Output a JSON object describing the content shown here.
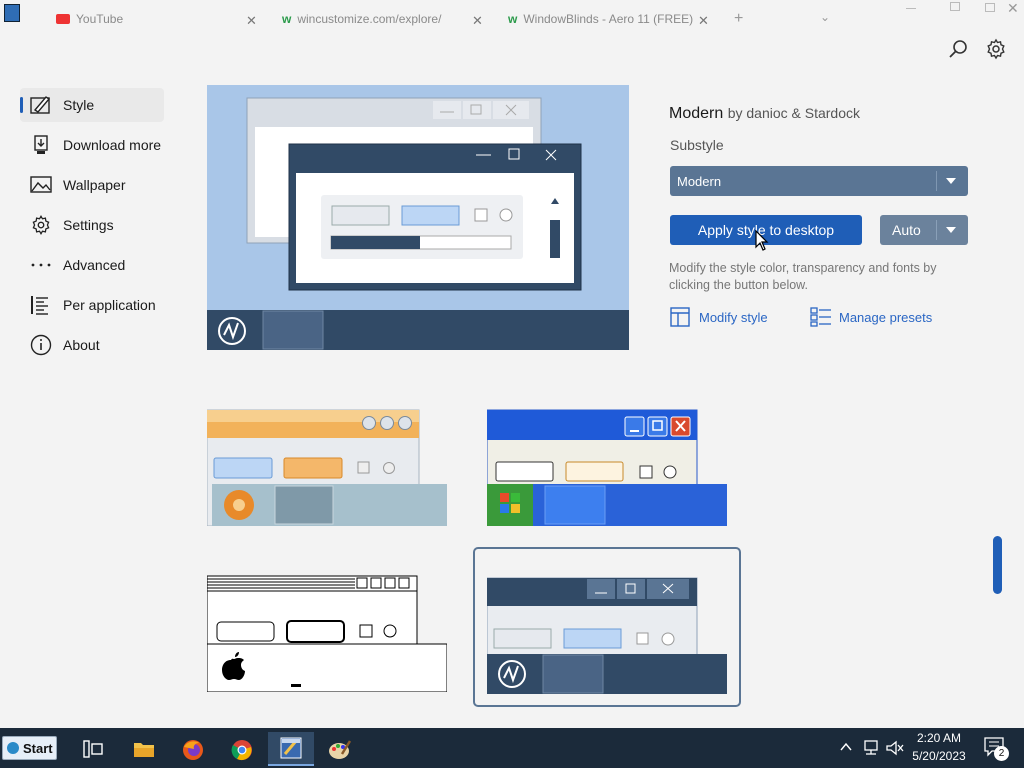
{
  "browser": {
    "tabs": [
      {
        "title": "YouTube"
      },
      {
        "title": "wincustomize.com/explore/"
      },
      {
        "title": "WindowBlinds - Aero 11 (FREE)"
      }
    ]
  },
  "sidebar": {
    "items": [
      {
        "label": "Style",
        "icon": "paint-brush-icon"
      },
      {
        "label": "Download more",
        "icon": "download-icon"
      },
      {
        "label": "Wallpaper",
        "icon": "image-icon"
      },
      {
        "label": "Settings",
        "icon": "gear-icon"
      },
      {
        "label": "Advanced",
        "icon": "more-dots-icon"
      },
      {
        "label": "Per application",
        "icon": "list-icon"
      },
      {
        "label": "About",
        "icon": "info-icon"
      }
    ]
  },
  "style": {
    "name": "Modern",
    "by": "by danioc & Stardock",
    "substyle_label": "Substyle",
    "substyle_value": "Modern",
    "apply_label": "Apply style to desktop",
    "auto_label": "Auto",
    "description": "Modify the style color, transparency and fonts by clicking the button below.",
    "modify_label": "Modify style",
    "presets_label": "Manage presets"
  },
  "taskbar": {
    "start_label": "Start",
    "time": "2:20 AM",
    "date": "5/20/2023",
    "notification_count": "2"
  },
  "colors": {
    "accent": "#1f5eb7",
    "preview_bg": "#a9c6e8",
    "taskbar": "#1b2a3a"
  }
}
